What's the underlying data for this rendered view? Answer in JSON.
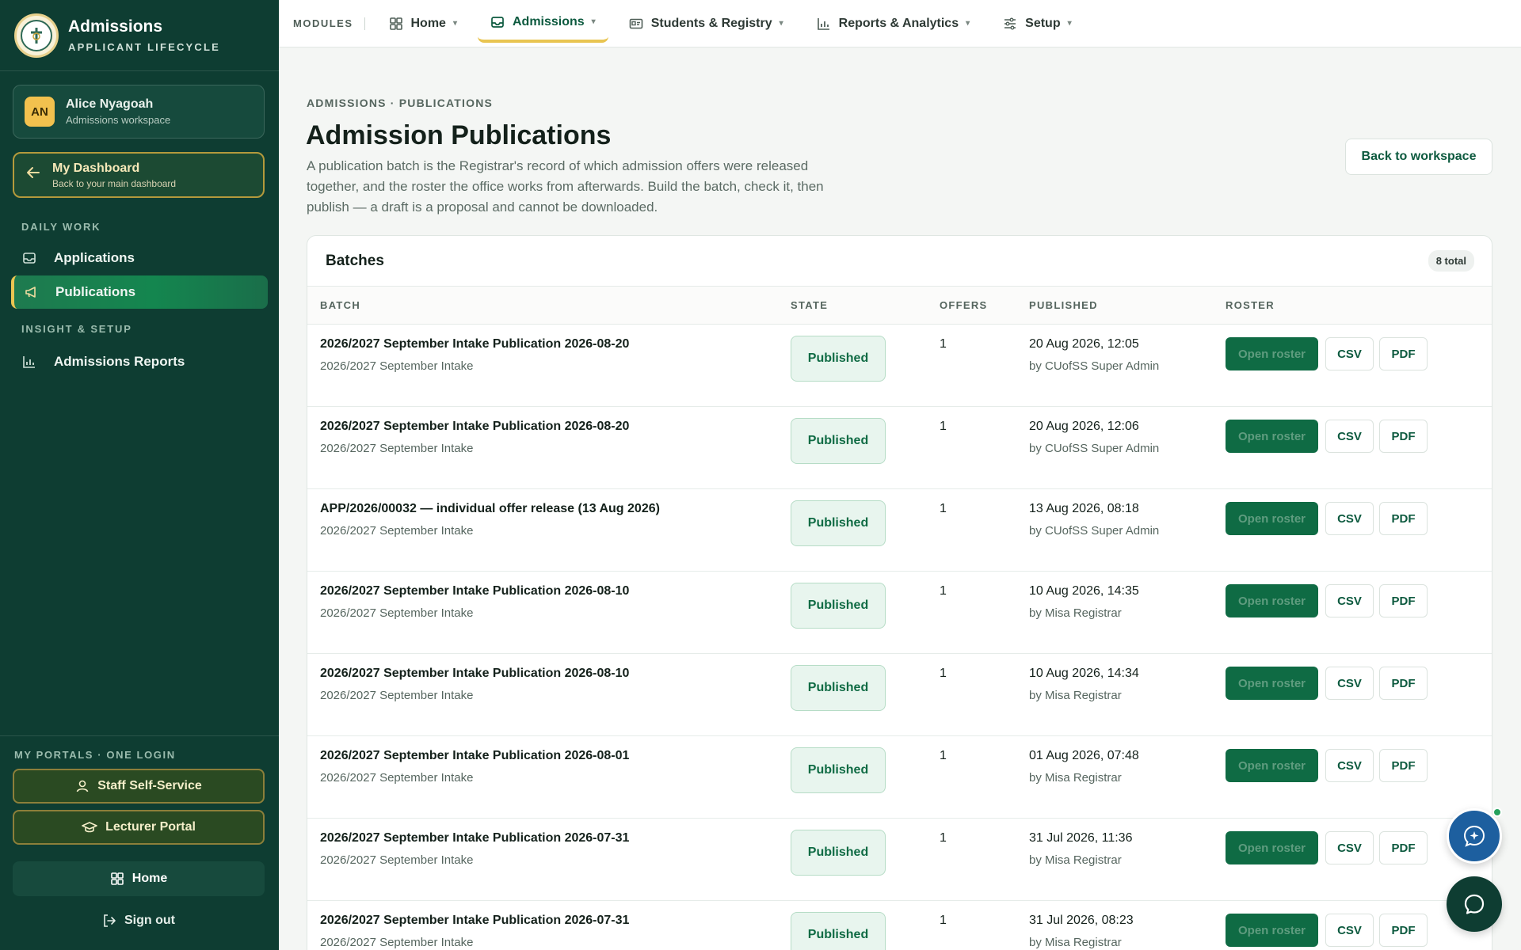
{
  "brand": {
    "title": "Admissions",
    "subtitle": "APPLICANT LIFECYCLE"
  },
  "user": {
    "initials": "AN",
    "name": "Alice Nyagoah",
    "role": "Admissions workspace"
  },
  "dashboard": {
    "title": "My Dashboard",
    "subtitle": "Back to your main dashboard"
  },
  "sidebar": {
    "section_daily": "DAILY WORK",
    "section_insight": "INSIGHT & SETUP",
    "items": [
      {
        "label": "Applications",
        "icon": "inbox-icon"
      },
      {
        "label": "Publications",
        "icon": "megaphone-icon",
        "active": true
      },
      {
        "label": "Admissions Reports",
        "icon": "bar-chart-icon"
      }
    ],
    "portals_label": "MY PORTALS · ONE LOGIN",
    "staff_portal": "Staff Self-Service",
    "lecturer_portal": "Lecturer Portal",
    "home": "Home",
    "sign_out": "Sign out"
  },
  "topnav": {
    "modules_label": "MODULES",
    "tabs": [
      {
        "label": "Home",
        "icon": "grid-icon"
      },
      {
        "label": "Admissions",
        "icon": "inbox-icon",
        "active": true
      },
      {
        "label": "Students & Registry",
        "icon": "id-card-icon"
      },
      {
        "label": "Reports & Analytics",
        "icon": "bar-chart-icon"
      },
      {
        "label": "Setup",
        "icon": "sliders-icon"
      }
    ]
  },
  "page": {
    "breadcrumb": "ADMISSIONS · PUBLICATIONS",
    "title": "Admission Publications",
    "description": "A publication batch is the Registrar's record of which admission offers were released together, and the roster the office works from afterwards. Build the batch, check it, then publish — a draft is a proposal and cannot be downloaded.",
    "back_button": "Back to workspace"
  },
  "batches": {
    "title": "Batches",
    "count": "8 total",
    "columns": {
      "batch": "BATCH",
      "state": "STATE",
      "offers": "OFFERS",
      "published": "PUBLISHED",
      "roster": "ROSTER"
    },
    "actions": {
      "open": "Open roster",
      "csv": "CSV",
      "pdf": "PDF"
    },
    "rows": [
      {
        "title": "2026/2027 September Intake Publication 2026-08-20",
        "intake": "2026/2027 September Intake",
        "state": "Published",
        "offers": "1",
        "date": "20 Aug 2026, 12:05",
        "by": "by CUofSS Super Admin"
      },
      {
        "title": "2026/2027 September Intake Publication 2026-08-20",
        "intake": "2026/2027 September Intake",
        "state": "Published",
        "offers": "1",
        "date": "20 Aug 2026, 12:06",
        "by": "by CUofSS Super Admin"
      },
      {
        "title": "APP/2026/00032 — individual offer release (13 Aug 2026)",
        "intake": "2026/2027 September Intake",
        "state": "Published",
        "offers": "1",
        "date": "13 Aug 2026, 08:18",
        "by": "by CUofSS Super Admin"
      },
      {
        "title": "2026/2027 September Intake Publication 2026-08-10",
        "intake": "2026/2027 September Intake",
        "state": "Published",
        "offers": "1",
        "date": "10 Aug 2026, 14:35",
        "by": "by Misa Registrar"
      },
      {
        "title": "2026/2027 September Intake Publication 2026-08-10",
        "intake": "2026/2027 September Intake",
        "state": "Published",
        "offers": "1",
        "date": "10 Aug 2026, 14:34",
        "by": "by Misa Registrar"
      },
      {
        "title": "2026/2027 September Intake Publication 2026-08-01",
        "intake": "2026/2027 September Intake",
        "state": "Published",
        "offers": "1",
        "date": "01 Aug 2026, 07:48",
        "by": "by Misa Registrar"
      },
      {
        "title": "2026/2027 September Intake Publication 2026-07-31",
        "intake": "2026/2027 September Intake",
        "state": "Published",
        "offers": "1",
        "date": "31 Jul 2026, 11:36",
        "by": "by Misa Registrar"
      },
      {
        "title": "2026/2027 September Intake Publication 2026-07-31",
        "intake": "2026/2027 September Intake",
        "state": "Published",
        "offers": "1",
        "date": "31 Jul 2026, 08:23",
        "by": "by Misa Registrar"
      }
    ]
  },
  "colors": {
    "sidebar_bg": "#0e3d32",
    "accent_gold": "#e9c552",
    "primary_green": "#0f6b44"
  }
}
